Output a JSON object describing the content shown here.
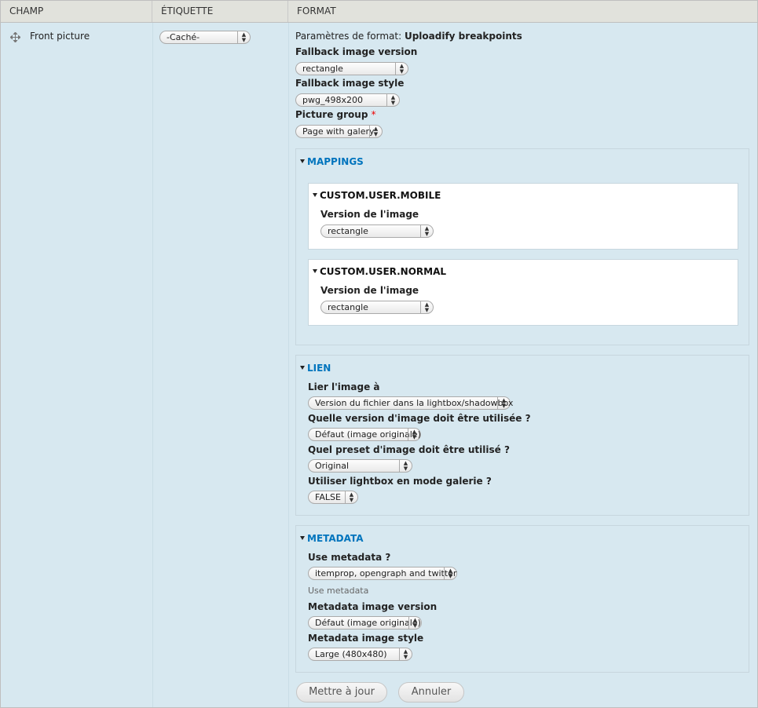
{
  "header": {
    "col_field": "CHAMP",
    "col_label": "ÉTIQUETTE",
    "col_format": "FORMAT"
  },
  "row": {
    "field_name": "Front picture",
    "label_select": "-Caché-",
    "format_settings_prefix": "Paramètres de format:",
    "format_settings_name": "Uploadify breakpoints",
    "fallback_version_label": "Fallback image version",
    "fallback_version_value": "rectangle",
    "fallback_style_label": "Fallback image style",
    "fallback_style_value": "pwg_498x200",
    "picture_group_label": "Picture group",
    "required_marker": "*",
    "picture_group_value": "Page with galery"
  },
  "mappings": {
    "legend": "MAPPINGS",
    "mobile": {
      "legend": "CUSTOM.USER.MOBILE",
      "label": "Version de l'image",
      "value": "rectangle"
    },
    "normal": {
      "legend": "CUSTOM.USER.NORMAL",
      "label": "Version de l'image",
      "value": "rectangle"
    }
  },
  "lien": {
    "legend": "LIEN",
    "link_label": "Lier l'image à",
    "link_value": "Version du fichier dans la lightbox/shadowbox",
    "version_label": "Quelle version d'image doit être utilisée ?",
    "version_value": "Défaut (image originale)",
    "preset_label": "Quel preset d'image doit être utilisé ?",
    "preset_value": "Original",
    "gallery_label": "Utiliser lightbox en mode galerie ?",
    "gallery_value": "FALSE"
  },
  "metadata": {
    "legend": "METADATA",
    "use_label": "Use metadata ?",
    "use_value": "itemprop, opengraph and twitter",
    "use_desc": "Use metadata",
    "version_label": "Metadata image version",
    "version_value": "Défaut (image originale)",
    "style_label": "Metadata image style",
    "style_value": "Large (480x480)"
  },
  "buttons": {
    "update": "Mettre à jour",
    "cancel": "Annuler"
  }
}
